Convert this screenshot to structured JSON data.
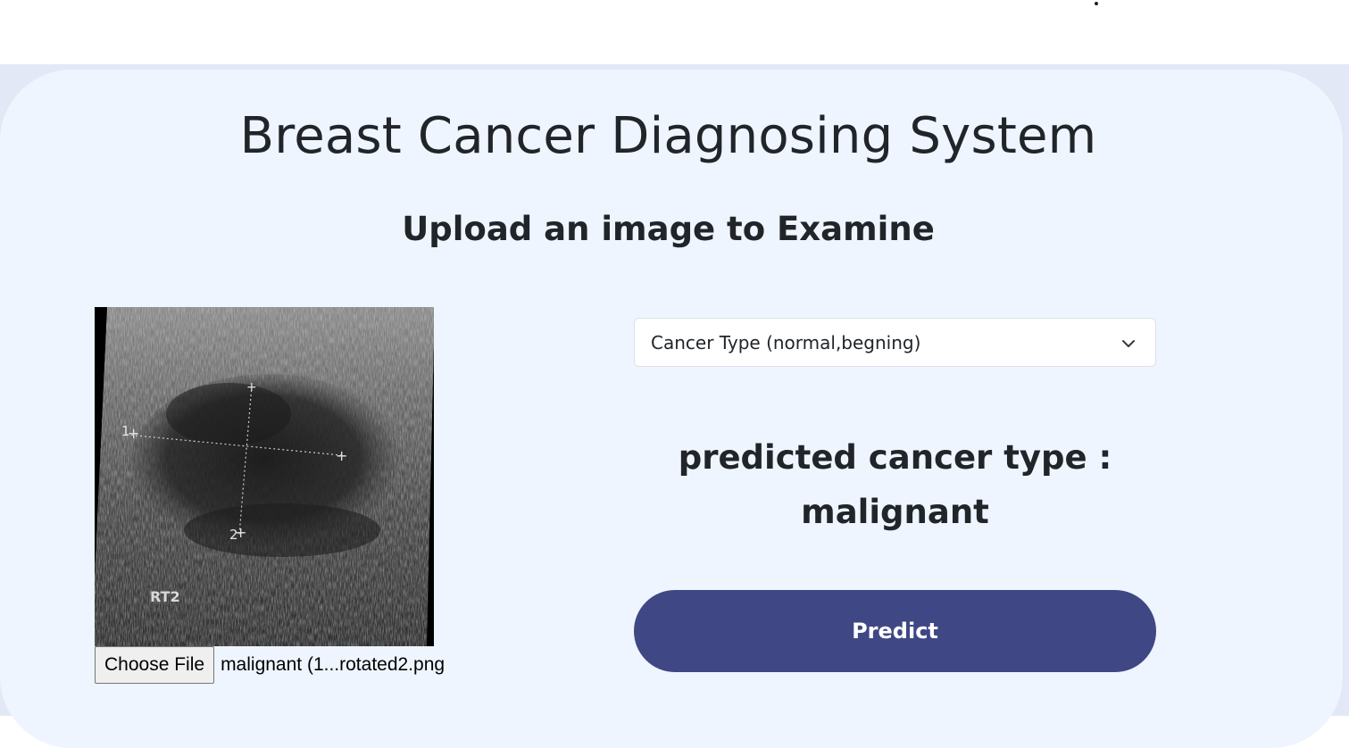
{
  "header": {
    "title": "Breast Cancer Diagnosing System",
    "subtitle": "Upload an image to Examine"
  },
  "upload": {
    "choose_file_label": "Choose File",
    "file_name": "malignant (1...rotated2.png",
    "image_overlay_label": "RT2",
    "marker_1": "1",
    "marker_2": "2"
  },
  "cancer_type_select": {
    "selected": "Cancer Type (normal,begning)"
  },
  "result": {
    "label": "predicted cancer type :",
    "value": "malignant"
  },
  "actions": {
    "predict_label": "Predict"
  },
  "colors": {
    "page_background": "#e3e8f7",
    "card_background": "#eef5fe",
    "predict_button": "#3f4784"
  }
}
